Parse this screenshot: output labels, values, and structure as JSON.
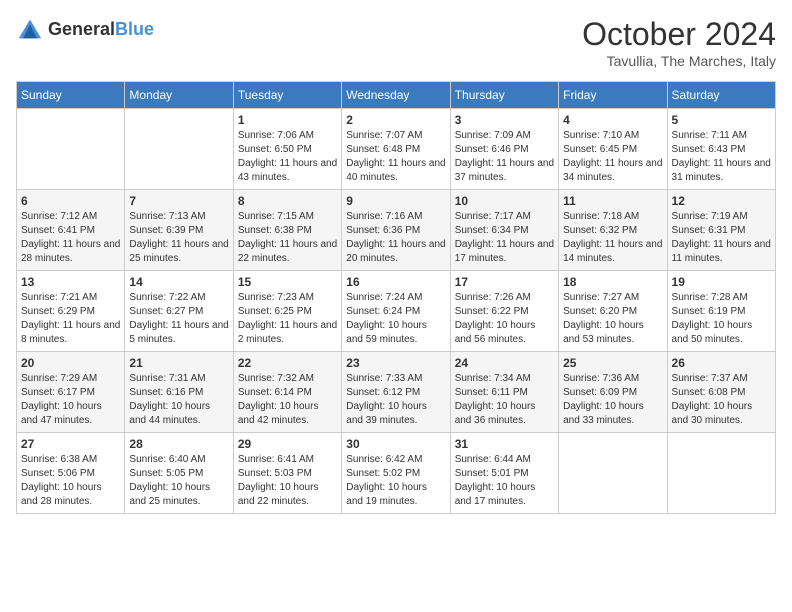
{
  "logo": {
    "general": "General",
    "blue": "Blue"
  },
  "title": "October 2024",
  "location": "Tavullia, The Marches, Italy",
  "days_of_week": [
    "Sunday",
    "Monday",
    "Tuesday",
    "Wednesday",
    "Thursday",
    "Friday",
    "Saturday"
  ],
  "weeks": [
    [
      {
        "day": "",
        "sunrise": "",
        "sunset": "",
        "daylight": ""
      },
      {
        "day": "",
        "sunrise": "",
        "sunset": "",
        "daylight": ""
      },
      {
        "day": "1",
        "sunrise": "Sunrise: 7:06 AM",
        "sunset": "Sunset: 6:50 PM",
        "daylight": "Daylight: 11 hours and 43 minutes."
      },
      {
        "day": "2",
        "sunrise": "Sunrise: 7:07 AM",
        "sunset": "Sunset: 6:48 PM",
        "daylight": "Daylight: 11 hours and 40 minutes."
      },
      {
        "day": "3",
        "sunrise": "Sunrise: 7:09 AM",
        "sunset": "Sunset: 6:46 PM",
        "daylight": "Daylight: 11 hours and 37 minutes."
      },
      {
        "day": "4",
        "sunrise": "Sunrise: 7:10 AM",
        "sunset": "Sunset: 6:45 PM",
        "daylight": "Daylight: 11 hours and 34 minutes."
      },
      {
        "day": "5",
        "sunrise": "Sunrise: 7:11 AM",
        "sunset": "Sunset: 6:43 PM",
        "daylight": "Daylight: 11 hours and 31 minutes."
      }
    ],
    [
      {
        "day": "6",
        "sunrise": "Sunrise: 7:12 AM",
        "sunset": "Sunset: 6:41 PM",
        "daylight": "Daylight: 11 hours and 28 minutes."
      },
      {
        "day": "7",
        "sunrise": "Sunrise: 7:13 AM",
        "sunset": "Sunset: 6:39 PM",
        "daylight": "Daylight: 11 hours and 25 minutes."
      },
      {
        "day": "8",
        "sunrise": "Sunrise: 7:15 AM",
        "sunset": "Sunset: 6:38 PM",
        "daylight": "Daylight: 11 hours and 22 minutes."
      },
      {
        "day": "9",
        "sunrise": "Sunrise: 7:16 AM",
        "sunset": "Sunset: 6:36 PM",
        "daylight": "Daylight: 11 hours and 20 minutes."
      },
      {
        "day": "10",
        "sunrise": "Sunrise: 7:17 AM",
        "sunset": "Sunset: 6:34 PM",
        "daylight": "Daylight: 11 hours and 17 minutes."
      },
      {
        "day": "11",
        "sunrise": "Sunrise: 7:18 AM",
        "sunset": "Sunset: 6:32 PM",
        "daylight": "Daylight: 11 hours and 14 minutes."
      },
      {
        "day": "12",
        "sunrise": "Sunrise: 7:19 AM",
        "sunset": "Sunset: 6:31 PM",
        "daylight": "Daylight: 11 hours and 11 minutes."
      }
    ],
    [
      {
        "day": "13",
        "sunrise": "Sunrise: 7:21 AM",
        "sunset": "Sunset: 6:29 PM",
        "daylight": "Daylight: 11 hours and 8 minutes."
      },
      {
        "day": "14",
        "sunrise": "Sunrise: 7:22 AM",
        "sunset": "Sunset: 6:27 PM",
        "daylight": "Daylight: 11 hours and 5 minutes."
      },
      {
        "day": "15",
        "sunrise": "Sunrise: 7:23 AM",
        "sunset": "Sunset: 6:25 PM",
        "daylight": "Daylight: 11 hours and 2 minutes."
      },
      {
        "day": "16",
        "sunrise": "Sunrise: 7:24 AM",
        "sunset": "Sunset: 6:24 PM",
        "daylight": "Daylight: 10 hours and 59 minutes."
      },
      {
        "day": "17",
        "sunrise": "Sunrise: 7:26 AM",
        "sunset": "Sunset: 6:22 PM",
        "daylight": "Daylight: 10 hours and 56 minutes."
      },
      {
        "day": "18",
        "sunrise": "Sunrise: 7:27 AM",
        "sunset": "Sunset: 6:20 PM",
        "daylight": "Daylight: 10 hours and 53 minutes."
      },
      {
        "day": "19",
        "sunrise": "Sunrise: 7:28 AM",
        "sunset": "Sunset: 6:19 PM",
        "daylight": "Daylight: 10 hours and 50 minutes."
      }
    ],
    [
      {
        "day": "20",
        "sunrise": "Sunrise: 7:29 AM",
        "sunset": "Sunset: 6:17 PM",
        "daylight": "Daylight: 10 hours and 47 minutes."
      },
      {
        "day": "21",
        "sunrise": "Sunrise: 7:31 AM",
        "sunset": "Sunset: 6:16 PM",
        "daylight": "Daylight: 10 hours and 44 minutes."
      },
      {
        "day": "22",
        "sunrise": "Sunrise: 7:32 AM",
        "sunset": "Sunset: 6:14 PM",
        "daylight": "Daylight: 10 hours and 42 minutes."
      },
      {
        "day": "23",
        "sunrise": "Sunrise: 7:33 AM",
        "sunset": "Sunset: 6:12 PM",
        "daylight": "Daylight: 10 hours and 39 minutes."
      },
      {
        "day": "24",
        "sunrise": "Sunrise: 7:34 AM",
        "sunset": "Sunset: 6:11 PM",
        "daylight": "Daylight: 10 hours and 36 minutes."
      },
      {
        "day": "25",
        "sunrise": "Sunrise: 7:36 AM",
        "sunset": "Sunset: 6:09 PM",
        "daylight": "Daylight: 10 hours and 33 minutes."
      },
      {
        "day": "26",
        "sunrise": "Sunrise: 7:37 AM",
        "sunset": "Sunset: 6:08 PM",
        "daylight": "Daylight: 10 hours and 30 minutes."
      }
    ],
    [
      {
        "day": "27",
        "sunrise": "Sunrise: 6:38 AM",
        "sunset": "Sunset: 5:06 PM",
        "daylight": "Daylight: 10 hours and 28 minutes."
      },
      {
        "day": "28",
        "sunrise": "Sunrise: 6:40 AM",
        "sunset": "Sunset: 5:05 PM",
        "daylight": "Daylight: 10 hours and 25 minutes."
      },
      {
        "day": "29",
        "sunrise": "Sunrise: 6:41 AM",
        "sunset": "Sunset: 5:03 PM",
        "daylight": "Daylight: 10 hours and 22 minutes."
      },
      {
        "day": "30",
        "sunrise": "Sunrise: 6:42 AM",
        "sunset": "Sunset: 5:02 PM",
        "daylight": "Daylight: 10 hours and 19 minutes."
      },
      {
        "day": "31",
        "sunrise": "Sunrise: 6:44 AM",
        "sunset": "Sunset: 5:01 PM",
        "daylight": "Daylight: 10 hours and 17 minutes."
      },
      {
        "day": "",
        "sunrise": "",
        "sunset": "",
        "daylight": ""
      },
      {
        "day": "",
        "sunrise": "",
        "sunset": "",
        "daylight": ""
      }
    ]
  ]
}
